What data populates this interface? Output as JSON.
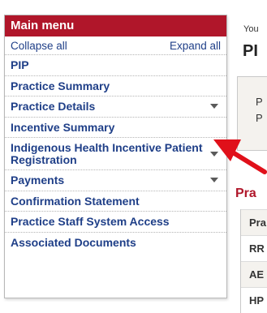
{
  "menu": {
    "header": "Main menu",
    "collapse_label": "Collapse all",
    "expand_label": "Expand all",
    "items": [
      {
        "label": "PIP",
        "has_caret": false
      },
      {
        "label": "Practice Summary",
        "has_caret": false
      },
      {
        "label": "Practice Details",
        "has_caret": true
      },
      {
        "label": "Incentive Summary",
        "has_caret": false
      },
      {
        "label": "Indigenous Health Incentive Patient Registration",
        "has_caret": true
      },
      {
        "label": "Payments",
        "has_caret": true
      },
      {
        "label": "Confirmation Statement",
        "has_caret": false
      },
      {
        "label": "Practice Staff System Access",
        "has_caret": false
      },
      {
        "label": "Associated Documents",
        "has_caret": false
      }
    ]
  },
  "page": {
    "you_label": "You",
    "title": "PI",
    "info_lines": [
      "P",
      "P"
    ],
    "section_title": "Pra",
    "table_rows": [
      "Pra",
      "RR",
      "AE",
      "HP"
    ]
  },
  "colors": {
    "brand_red": "#b0162a",
    "link_blue": "#1f3f88",
    "arrow_red": "#e0101a"
  }
}
